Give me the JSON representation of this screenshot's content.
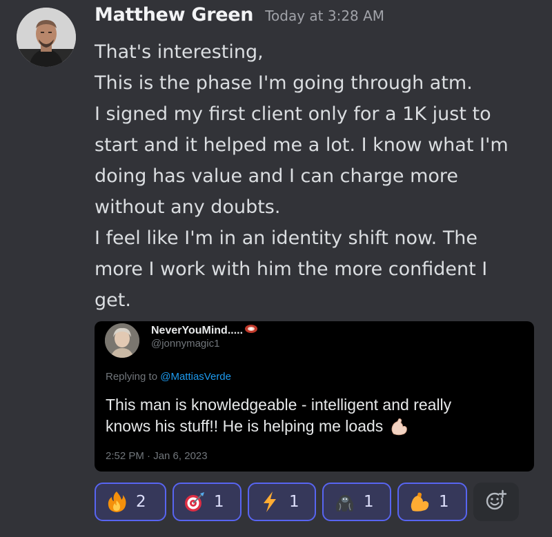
{
  "message": {
    "author": "Matthew Green",
    "timestamp": "Today at 3:28 AM",
    "lines": [
      "That's interesting,",
      "This is the phase I'm going through atm.",
      "I signed my first client only for a 1K just to",
      "start and it helped me a lot. I know what I'm",
      "doing has value and I can charge more",
      "without any doubts.",
      "I feel like I'm in an identity shift now. The",
      "more I work with him the more confident I",
      "get."
    ]
  },
  "embed": {
    "name": "NeverYouMind.....",
    "handle": "@jonnymagic1",
    "replying_prefix": "Replying to ",
    "replying_to": "@MattiasVerde",
    "text_lines": [
      "This man is knowledgeable - intelligent and really",
      "knows his stuff!!  He is helping me loads"
    ],
    "date": "2:52 PM · Jan 6, 2023"
  },
  "reactions": [
    {
      "icon": "fire-icon",
      "count": "2"
    },
    {
      "icon": "dart-icon",
      "count": "1"
    },
    {
      "icon": "lightning-icon",
      "count": "1"
    },
    {
      "icon": "gorilla-icon",
      "count": "1"
    },
    {
      "icon": "flexed-biceps-icon",
      "count": "1"
    }
  ],
  "colors": {
    "background": "#323338",
    "reaction_border": "#5865f2",
    "reaction_bg": "#36385a",
    "link": "#1d9bf0"
  }
}
